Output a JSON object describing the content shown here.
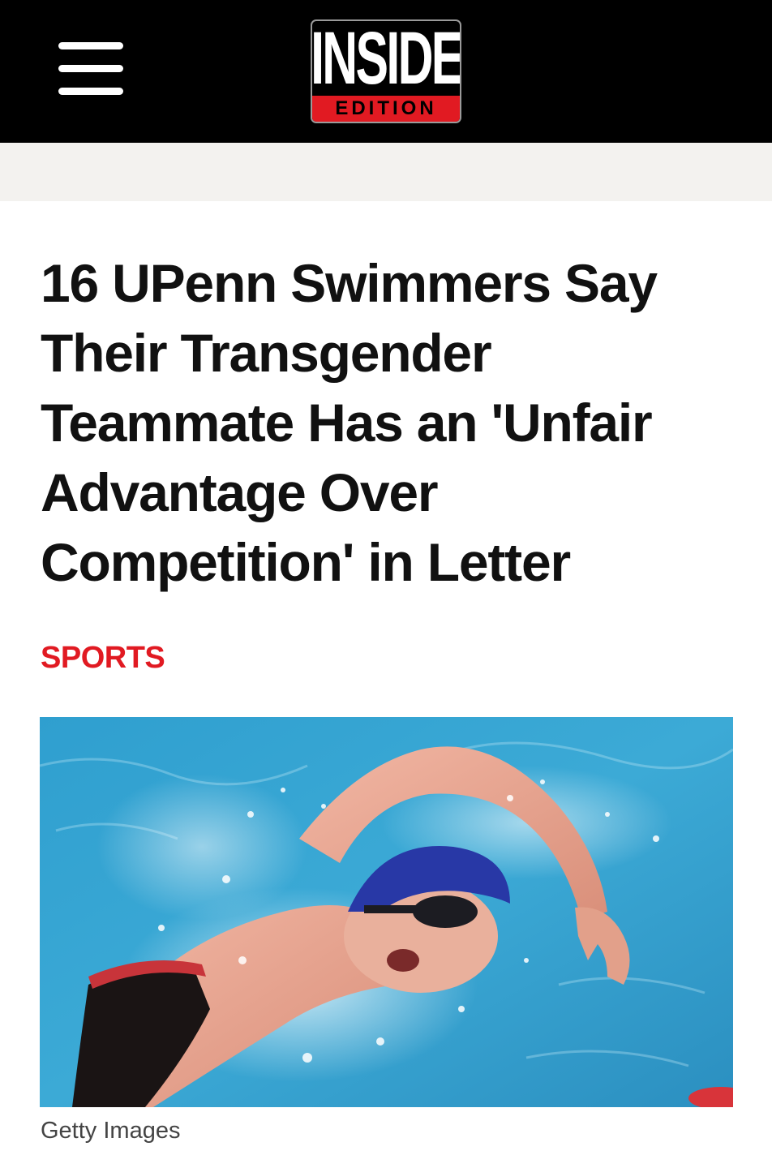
{
  "header": {
    "menu_icon": "hamburger-menu-icon",
    "logo": {
      "line1": "INSIDE",
      "line2": "EDITION",
      "bar_color": "#e11a22"
    }
  },
  "article": {
    "title": "16 UPenn Swimmers Say Their Transgender Teammate Has an 'Unfair Advantage Over Competition' in Letter",
    "category": "SPORTS",
    "category_color": "#e11a22",
    "image_credit": "Getty Images"
  }
}
